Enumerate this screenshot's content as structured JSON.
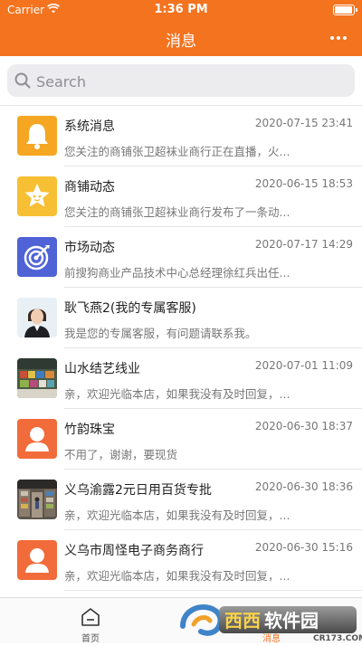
{
  "status_bar": {
    "carrier": "Carrier",
    "time": "1:36 PM"
  },
  "nav": {
    "title": "消息"
  },
  "search": {
    "placeholder": "Search"
  },
  "conversations": [
    {
      "name": "系统消息",
      "time": "2020-07-15 23:41",
      "preview": "您关注的商铺张卫超袜业商行正在直播，火...",
      "avatar": "bell-icon",
      "color": "#f5a623"
    },
    {
      "name": "商铺动态",
      "time": "2020-06-15 18:53",
      "preview": "您关注的商铺张卫超袜业商行发布了一条动...",
      "avatar": "star-icon",
      "color": "#f7c034"
    },
    {
      "name": "市场动态",
      "time": "2020-07-17 14:29",
      "preview": "前搜狗商业产品技术中心总经理徐红兵出任...",
      "avatar": "target-icon",
      "color": "#4f63d6"
    },
    {
      "name": "耿飞燕2(我的专属客服)",
      "time": "",
      "preview": "我是您的专属客服，有问题请联系我。",
      "avatar": "person-photo",
      "color": "#d9e6ef"
    },
    {
      "name": "山水结艺线业",
      "time": "2020-07-01 11:09",
      "preview": "亲，欢迎光临本店，如果我没有及时回复，...",
      "avatar": "shop-photo",
      "color": "#5a6b4a"
    },
    {
      "name": "竹韵珠宝",
      "time": "2020-06-30 18:37",
      "preview": "不用了，谢谢，要现货",
      "avatar": "user-icon",
      "color": "#f26b3a"
    },
    {
      "name": "义乌渝露2元日用百货专批",
      "time": "2020-06-30 18:36",
      "preview": "亲，欢迎光临本店，如果我没有及时回复，...",
      "avatar": "shop-photo",
      "color": "#6a6158"
    },
    {
      "name": "义乌市周怪电子商务商行",
      "time": "2020-06-30 15:16",
      "preview": "亲，欢迎光临本店，如果我没有及时回复，...",
      "avatar": "user-icon",
      "color": "#f26b3a"
    }
  ],
  "tabs": [
    {
      "label": "首页",
      "icon": "home-icon"
    },
    {
      "label": "消息",
      "icon": "message-icon"
    }
  ],
  "watermark": {
    "text": "西西软件园",
    "url_text": "CR173.COM"
  },
  "colors": {
    "accent": "#f4731f"
  }
}
